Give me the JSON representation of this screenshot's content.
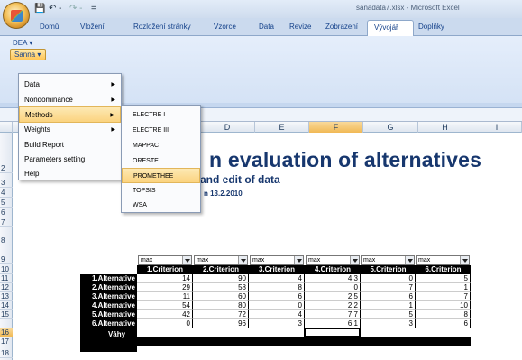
{
  "window": {
    "title": "sanadata7.xlsx - Microsoft Excel",
    "quick_access": [
      "💾",
      "↶ -",
      "↷ -",
      "="
    ]
  },
  "ribbon": {
    "tabs": [
      "Domů",
      "Vložení",
      "Rozložení stránky",
      "Vzorce",
      "Data",
      "Revize",
      "Zobrazení",
      "Vývojář",
      "Doplňky"
    ],
    "active_tab": "Doplňky",
    "dea_label": "DEA ▾",
    "sanna_label": "Sanna ▾"
  },
  "sheet": {
    "columns": [
      "D",
      "E",
      "F",
      "G",
      "H",
      "I"
    ],
    "rows": [
      "2",
      "3",
      "4",
      "5",
      "6",
      "7",
      "8",
      "9",
      "10",
      "11",
      "12",
      "13",
      "14",
      "15",
      "16",
      "17",
      "18"
    ],
    "title": "n evaluation of alternatives",
    "subtitle": "and edit of data",
    "version": "n 13.2.2010"
  },
  "menu": {
    "items": [
      {
        "label": "Data",
        "submenu": true
      },
      {
        "label": "Nondominance",
        "submenu": true
      },
      {
        "label": "Methods",
        "submenu": true
      },
      {
        "label": "Weights",
        "submenu": true
      },
      {
        "label": "Build Report",
        "submenu": false
      },
      {
        "label": "Parameters setting",
        "submenu": false
      },
      {
        "label": "Help",
        "submenu": false
      }
    ],
    "methods": [
      "ELECTRE I",
      "ELECTRE III",
      "MAPPAC",
      "ORESTE",
      "PROMETHEE",
      "TOPSIS",
      "WSA"
    ]
  },
  "table": {
    "dropdown_value": "max",
    "criteria": [
      "1.Criterion",
      "2.Criterion",
      "3.Criterion",
      "4.Criterion",
      "5.Criterion",
      "6.Criterion"
    ],
    "alternatives": [
      "1.Alternative",
      "2.Alternative",
      "3.Alternative",
      "4.Alternative",
      "5.Alternative",
      "6.Alternative"
    ],
    "values": [
      [
        "14",
        "90",
        "4",
        "4.3",
        "0",
        "5"
      ],
      [
        "29",
        "58",
        "8",
        "0",
        "7",
        "1"
      ],
      [
        "11",
        "60",
        "6",
        "2.5",
        "6",
        "7"
      ],
      [
        "54",
        "80",
        "0",
        "2.2",
        "1",
        "10"
      ],
      [
        "42",
        "72",
        "4",
        "7.7",
        "5",
        "8"
      ],
      [
        "0",
        "96",
        "3",
        "6.1",
        "3",
        "6"
      ]
    ],
    "weights_label": "Váhy"
  }
}
